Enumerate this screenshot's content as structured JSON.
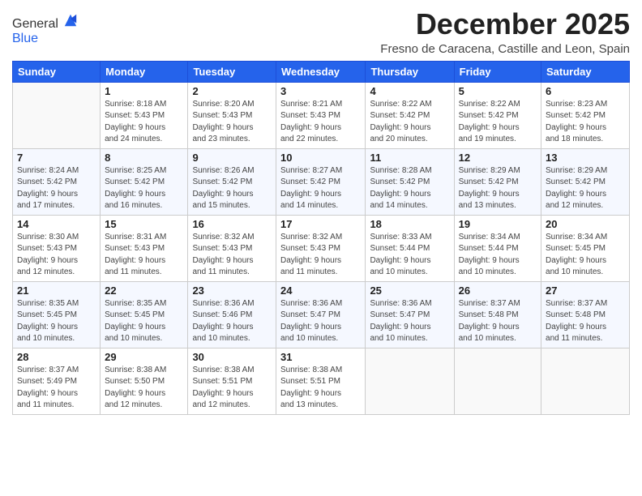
{
  "logo": {
    "general": "General",
    "blue": "Blue"
  },
  "header": {
    "month_year": "December 2025",
    "location": "Fresno de Caracena, Castille and Leon, Spain"
  },
  "weekdays": [
    "Sunday",
    "Monday",
    "Tuesday",
    "Wednesday",
    "Thursday",
    "Friday",
    "Saturday"
  ],
  "weeks": [
    [
      {
        "day": "",
        "info": ""
      },
      {
        "day": "1",
        "info": "Sunrise: 8:18 AM\nSunset: 5:43 PM\nDaylight: 9 hours\nand 24 minutes."
      },
      {
        "day": "2",
        "info": "Sunrise: 8:20 AM\nSunset: 5:43 PM\nDaylight: 9 hours\nand 23 minutes."
      },
      {
        "day": "3",
        "info": "Sunrise: 8:21 AM\nSunset: 5:43 PM\nDaylight: 9 hours\nand 22 minutes."
      },
      {
        "day": "4",
        "info": "Sunrise: 8:22 AM\nSunset: 5:42 PM\nDaylight: 9 hours\nand 20 minutes."
      },
      {
        "day": "5",
        "info": "Sunrise: 8:22 AM\nSunset: 5:42 PM\nDaylight: 9 hours\nand 19 minutes."
      },
      {
        "day": "6",
        "info": "Sunrise: 8:23 AM\nSunset: 5:42 PM\nDaylight: 9 hours\nand 18 minutes."
      }
    ],
    [
      {
        "day": "7",
        "info": "Sunrise: 8:24 AM\nSunset: 5:42 PM\nDaylight: 9 hours\nand 17 minutes."
      },
      {
        "day": "8",
        "info": "Sunrise: 8:25 AM\nSunset: 5:42 PM\nDaylight: 9 hours\nand 16 minutes."
      },
      {
        "day": "9",
        "info": "Sunrise: 8:26 AM\nSunset: 5:42 PM\nDaylight: 9 hours\nand 15 minutes."
      },
      {
        "day": "10",
        "info": "Sunrise: 8:27 AM\nSunset: 5:42 PM\nDaylight: 9 hours\nand 14 minutes."
      },
      {
        "day": "11",
        "info": "Sunrise: 8:28 AM\nSunset: 5:42 PM\nDaylight: 9 hours\nand 14 minutes."
      },
      {
        "day": "12",
        "info": "Sunrise: 8:29 AM\nSunset: 5:42 PM\nDaylight: 9 hours\nand 13 minutes."
      },
      {
        "day": "13",
        "info": "Sunrise: 8:29 AM\nSunset: 5:42 PM\nDaylight: 9 hours\nand 12 minutes."
      }
    ],
    [
      {
        "day": "14",
        "info": "Sunrise: 8:30 AM\nSunset: 5:43 PM\nDaylight: 9 hours\nand 12 minutes."
      },
      {
        "day": "15",
        "info": "Sunrise: 8:31 AM\nSunset: 5:43 PM\nDaylight: 9 hours\nand 11 minutes."
      },
      {
        "day": "16",
        "info": "Sunrise: 8:32 AM\nSunset: 5:43 PM\nDaylight: 9 hours\nand 11 minutes."
      },
      {
        "day": "17",
        "info": "Sunrise: 8:32 AM\nSunset: 5:43 PM\nDaylight: 9 hours\nand 11 minutes."
      },
      {
        "day": "18",
        "info": "Sunrise: 8:33 AM\nSunset: 5:44 PM\nDaylight: 9 hours\nand 10 minutes."
      },
      {
        "day": "19",
        "info": "Sunrise: 8:34 AM\nSunset: 5:44 PM\nDaylight: 9 hours\nand 10 minutes."
      },
      {
        "day": "20",
        "info": "Sunrise: 8:34 AM\nSunset: 5:45 PM\nDaylight: 9 hours\nand 10 minutes."
      }
    ],
    [
      {
        "day": "21",
        "info": "Sunrise: 8:35 AM\nSunset: 5:45 PM\nDaylight: 9 hours\nand 10 minutes."
      },
      {
        "day": "22",
        "info": "Sunrise: 8:35 AM\nSunset: 5:45 PM\nDaylight: 9 hours\nand 10 minutes."
      },
      {
        "day": "23",
        "info": "Sunrise: 8:36 AM\nSunset: 5:46 PM\nDaylight: 9 hours\nand 10 minutes."
      },
      {
        "day": "24",
        "info": "Sunrise: 8:36 AM\nSunset: 5:47 PM\nDaylight: 9 hours\nand 10 minutes."
      },
      {
        "day": "25",
        "info": "Sunrise: 8:36 AM\nSunset: 5:47 PM\nDaylight: 9 hours\nand 10 minutes."
      },
      {
        "day": "26",
        "info": "Sunrise: 8:37 AM\nSunset: 5:48 PM\nDaylight: 9 hours\nand 10 minutes."
      },
      {
        "day": "27",
        "info": "Sunrise: 8:37 AM\nSunset: 5:48 PM\nDaylight: 9 hours\nand 11 minutes."
      }
    ],
    [
      {
        "day": "28",
        "info": "Sunrise: 8:37 AM\nSunset: 5:49 PM\nDaylight: 9 hours\nand 11 minutes."
      },
      {
        "day": "29",
        "info": "Sunrise: 8:38 AM\nSunset: 5:50 PM\nDaylight: 9 hours\nand 12 minutes."
      },
      {
        "day": "30",
        "info": "Sunrise: 8:38 AM\nSunset: 5:51 PM\nDaylight: 9 hours\nand 12 minutes."
      },
      {
        "day": "31",
        "info": "Sunrise: 8:38 AM\nSunset: 5:51 PM\nDaylight: 9 hours\nand 13 minutes."
      },
      {
        "day": "",
        "info": ""
      },
      {
        "day": "",
        "info": ""
      },
      {
        "day": "",
        "info": ""
      }
    ]
  ]
}
